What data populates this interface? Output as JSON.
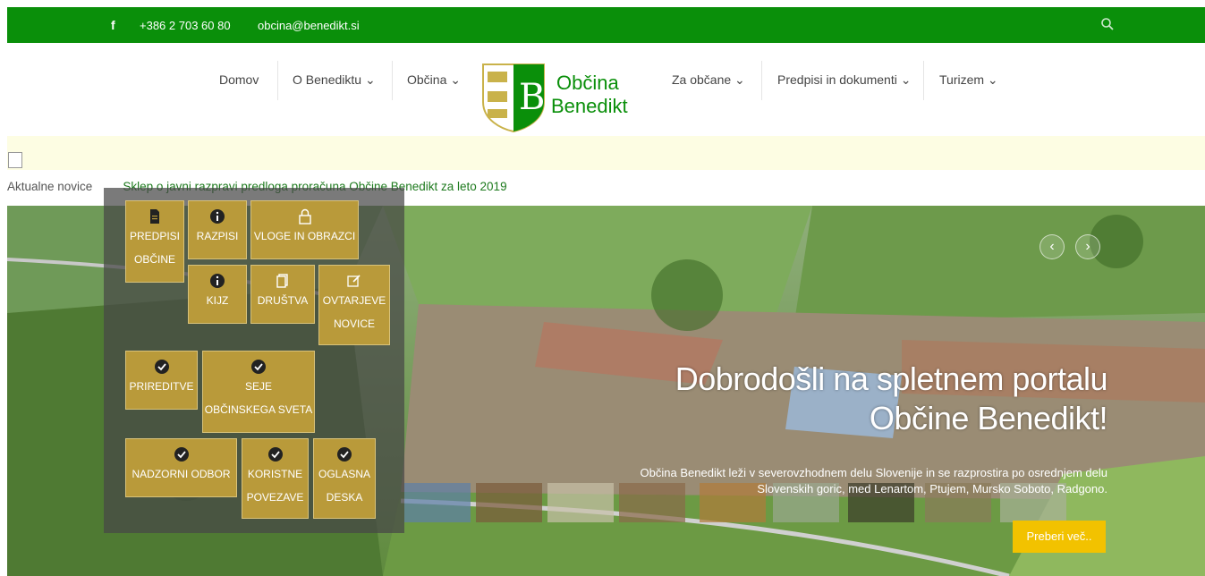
{
  "topbar": {
    "facebook": "f",
    "phone": "+386 2 703 60 80",
    "email": "obcina@benedikt.si"
  },
  "nav": {
    "items": [
      {
        "label": "Domov"
      },
      {
        "label": "O Benediktu ⌄"
      },
      {
        "label": "Občina ⌄"
      },
      {
        "label": "Za občane ⌄"
      },
      {
        "label": "Predpisi in dokumenti ⌄"
      },
      {
        "label": "Turizem ⌄"
      }
    ],
    "logo_line1": "Občina",
    "logo_line2": "Benedikt"
  },
  "ticker": {
    "label": "Aktualne novice",
    "headline": "Sklep o javni razpravi predloga proračuna Občine Benedikt za leto 2019"
  },
  "tiles": [
    {
      "line1": "PREDPISI",
      "line2": "OBČINE",
      "icon": "document-icon"
    },
    {
      "line1": "RAZPISI",
      "line2": "",
      "icon": "info-icon"
    },
    {
      "line1": "VLOGE IN OBRAZCI",
      "line2": "",
      "icon": "lock-icon"
    },
    {
      "line1": "KIJZ",
      "line2": "",
      "icon": "info-icon"
    },
    {
      "line1": "DRUŠTVA",
      "line2": "",
      "icon": "copy-icon"
    },
    {
      "line1": "OVTARJEVE",
      "line2": "NOVICE",
      "icon": "edit-icon"
    },
    {
      "line1": "PRIREDITVE",
      "line2": "",
      "icon": "check-icon"
    },
    {
      "line1": "SEJE",
      "line2": "OBČINSKEGA SVETA",
      "icon": "check-icon"
    },
    {
      "line1": "NADZORNI ODBOR",
      "line2": "",
      "icon": "check-icon"
    },
    {
      "line1": "KORISTNE",
      "line2": "POVEZAVE",
      "icon": "check-icon"
    },
    {
      "line1": "OGLASNA",
      "line2": "DESKA",
      "icon": "check-icon"
    }
  ],
  "hero": {
    "title_line1": "Dobrodošli na spletnem portalu",
    "title_line2": "Občine Benedikt!",
    "text": "Občina Benedikt leži v severovzhodnem delu Slovenije in se razprostira po osrednjem delu Slovenskih goric, med Lenartom, Ptujem, Mursko Soboto, Radgono.",
    "readmore": "Preberi več.."
  },
  "colors": {
    "brand_green": "#0a8f0a",
    "tile_gold": "#b99a3a",
    "button_yellow": "#f2c200"
  }
}
